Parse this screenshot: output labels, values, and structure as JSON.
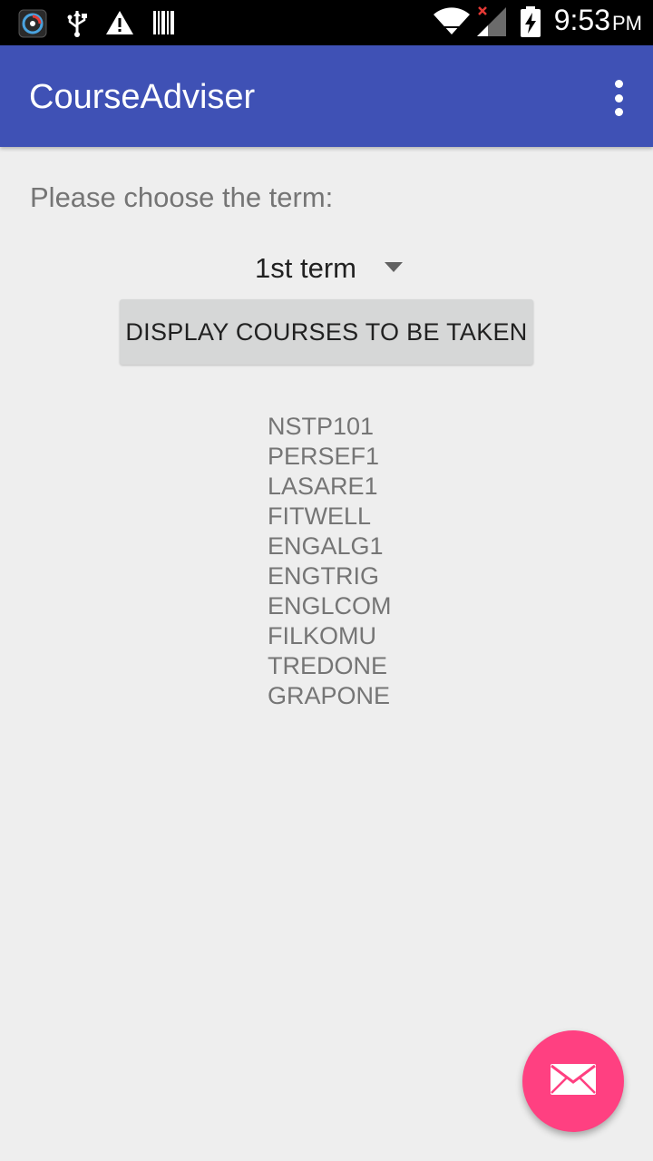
{
  "status_bar": {
    "time": "9:53",
    "ampm": "PM",
    "icons": [
      "app-notification-icon",
      "usb-icon",
      "warning-icon",
      "barcode-icon",
      "wifi-icon",
      "signal-icon",
      "battery-charging-icon"
    ]
  },
  "app_bar": {
    "title": "CourseAdviser",
    "overflow_icon": "overflow-menu-icon"
  },
  "content": {
    "prompt": "Please choose the term:",
    "term_selected": "1st term",
    "display_button_label": "DISPLAY COURSES TO BE TAKEN",
    "courses": [
      "NSTP101",
      "PERSEF1",
      "LASARE1",
      "FITWELL",
      "ENGALG1",
      "ENGTRIG",
      "ENGLCOM",
      "FILKOMU",
      "TREDONE",
      "GRAPONE"
    ]
  },
  "fab": {
    "icon": "email-icon"
  },
  "colors": {
    "primary": "#3f51b5",
    "accent": "#ff4081",
    "background": "#eeeeee",
    "button": "#d6d7d7"
  }
}
